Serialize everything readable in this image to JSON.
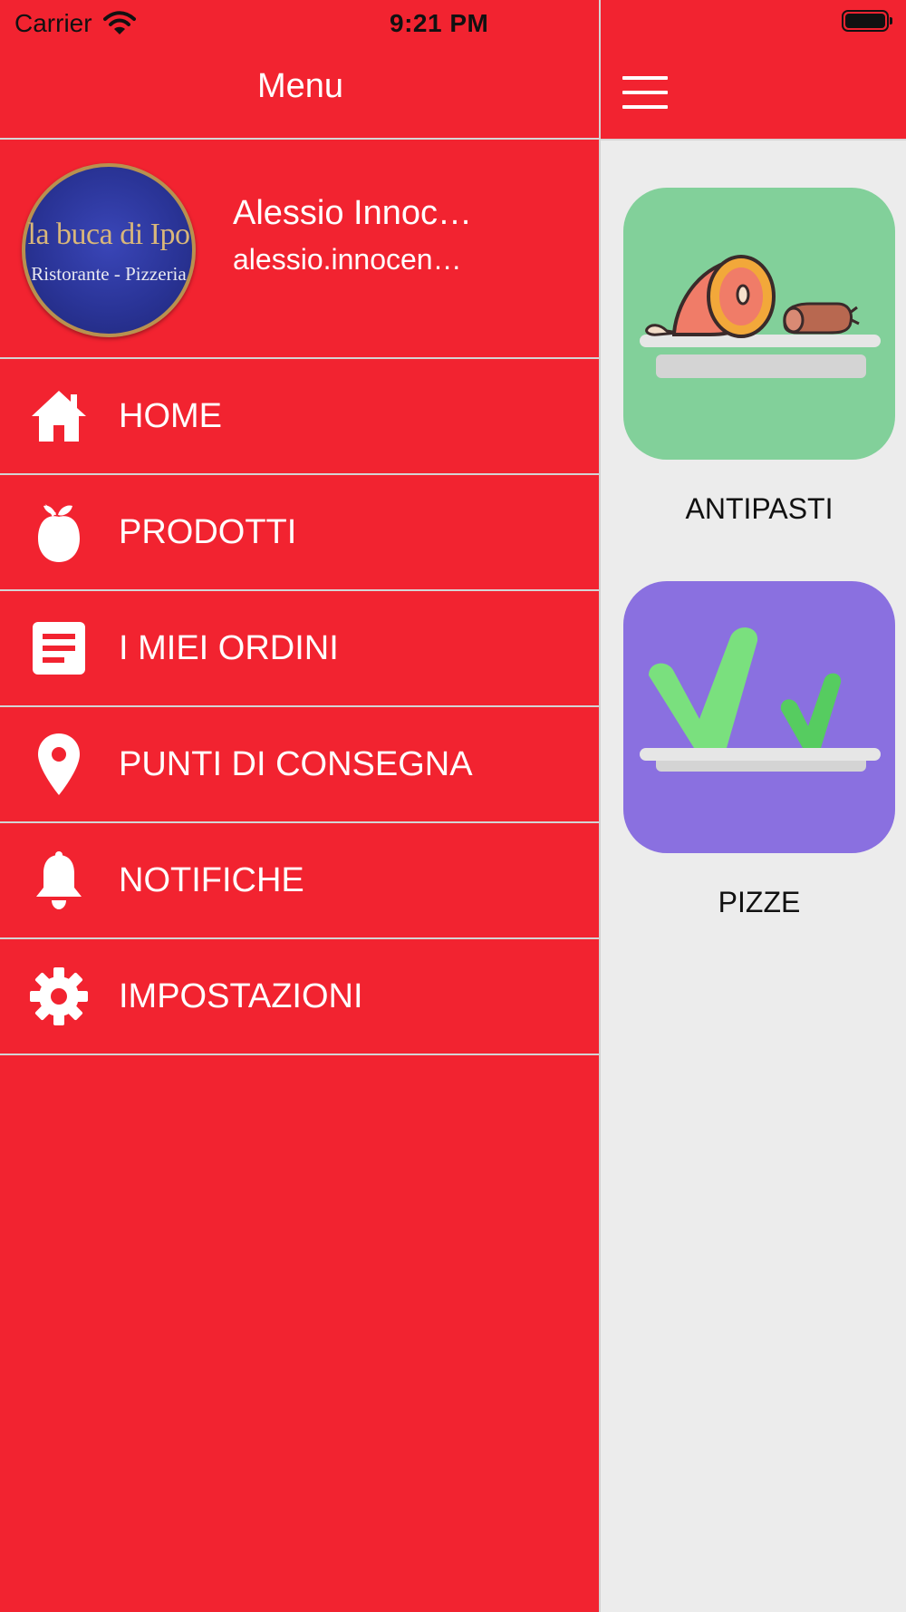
{
  "status_bar": {
    "carrier": "Carrier",
    "time": "9:21 PM"
  },
  "drawer": {
    "title": "Menu",
    "logo": {
      "title": "la buca di Ipo",
      "subtitle": "Ristorante - Pizzeria"
    },
    "user": {
      "name": "Alessio Innoc…",
      "email": "alessio.innocen…"
    },
    "menu_items": [
      {
        "label": "HOME",
        "icon": "home-icon"
      },
      {
        "label": "PRODOTTI",
        "icon": "fruit-icon"
      },
      {
        "label": "I MIEI ORDINI",
        "icon": "orders-icon"
      },
      {
        "label": "PUNTI DI CONSEGNA",
        "icon": "location-pin-icon"
      },
      {
        "label": "NOTIFICHE",
        "icon": "bell-icon"
      },
      {
        "label": "IMPOSTAZIONI",
        "icon": "gear-icon"
      }
    ]
  },
  "content": {
    "header": {
      "menu_icon": "hamburger-icon"
    },
    "categories": [
      {
        "label": "ANTIPASTI",
        "image": "ham-salami-icon",
        "bg": "#82d09a"
      },
      {
        "label": "PIZZE",
        "image": "greens-icon",
        "bg": "#8a70e0"
      }
    ]
  },
  "colors": {
    "brand_red": "#f22330",
    "panel_bg": "#ececec",
    "divider": "#d4d4d4"
  }
}
